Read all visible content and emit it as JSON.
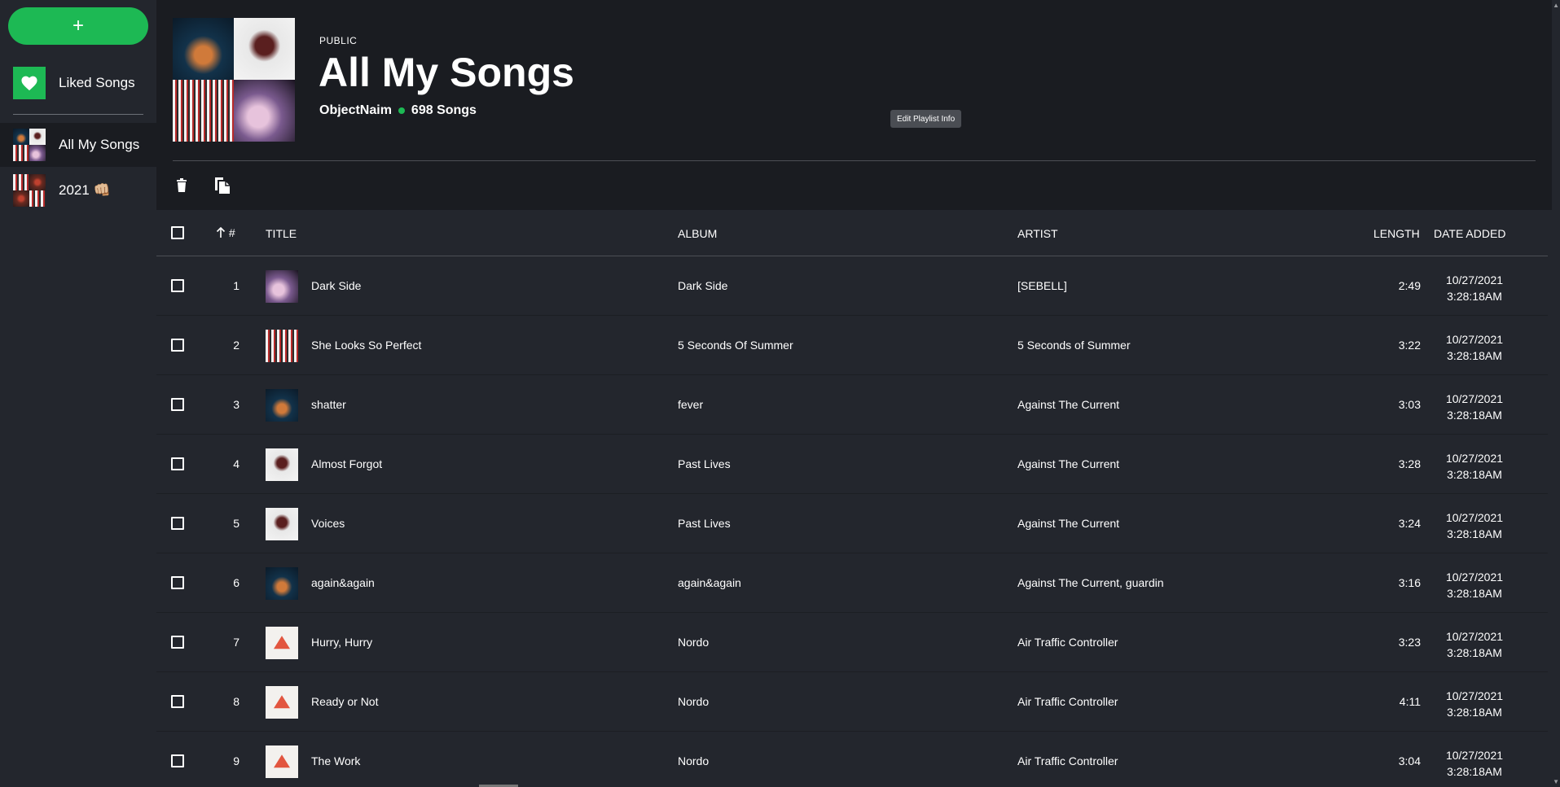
{
  "sidebar": {
    "add_label": "+",
    "liked_label": "Liked Songs",
    "playlists": [
      {
        "label": "All My Songs"
      },
      {
        "label": "2021 👊🏼"
      }
    ]
  },
  "header": {
    "visibility": "PUBLIC",
    "title": "All My Songs",
    "owner": "ObjectNaim",
    "song_count": "698 Songs",
    "edit_label": "Edit Playlist Info"
  },
  "table": {
    "columns": {
      "number": "#",
      "title": "TITLE",
      "album": "ALBUM",
      "artist": "ARTIST",
      "length": "LENGTH",
      "date_added": "DATE ADDED"
    },
    "rows": [
      {
        "n": "1",
        "title": "Dark Side",
        "album": "Dark Side",
        "artist": "[SEBELL]",
        "length": "2:49",
        "date": "10/27/2021",
        "time": "3:28:18AM"
      },
      {
        "n": "2",
        "title": "She Looks So Perfect",
        "album": "5 Seconds Of Summer",
        "artist": "5 Seconds of Summer",
        "length": "3:22",
        "date": "10/27/2021",
        "time": "3:28:18AM"
      },
      {
        "n": "3",
        "title": "shatter",
        "album": "fever",
        "artist": "Against The Current",
        "length": "3:03",
        "date": "10/27/2021",
        "time": "3:28:18AM"
      },
      {
        "n": "4",
        "title": "Almost Forgot",
        "album": "Past Lives",
        "artist": "Against The Current",
        "length": "3:28",
        "date": "10/27/2021",
        "time": "3:28:18AM"
      },
      {
        "n": "5",
        "title": "Voices",
        "album": "Past Lives",
        "artist": "Against The Current",
        "length": "3:24",
        "date": "10/27/2021",
        "time": "3:28:18AM"
      },
      {
        "n": "6",
        "title": "again&again",
        "album": "again&again",
        "artist": "Against The Current, guardin",
        "length": "3:16",
        "date": "10/27/2021",
        "time": "3:28:18AM"
      },
      {
        "n": "7",
        "title": "Hurry, Hurry",
        "album": "Nordo",
        "artist": "Air Traffic Controller",
        "length": "3:23",
        "date": "10/27/2021",
        "time": "3:28:18AM"
      },
      {
        "n": "8",
        "title": "Ready or Not",
        "album": "Nordo",
        "artist": "Air Traffic Controller",
        "length": "4:11",
        "date": "10/27/2021",
        "time": "3:28:18AM"
      },
      {
        "n": "9",
        "title": "The Work",
        "album": "Nordo",
        "artist": "Air Traffic Controller",
        "length": "3:04",
        "date": "10/27/2021",
        "time": "3:28:18AM"
      }
    ]
  },
  "colors": {
    "accent": "#1db954",
    "background": "#23262d",
    "header_background": "#1a1c21"
  }
}
